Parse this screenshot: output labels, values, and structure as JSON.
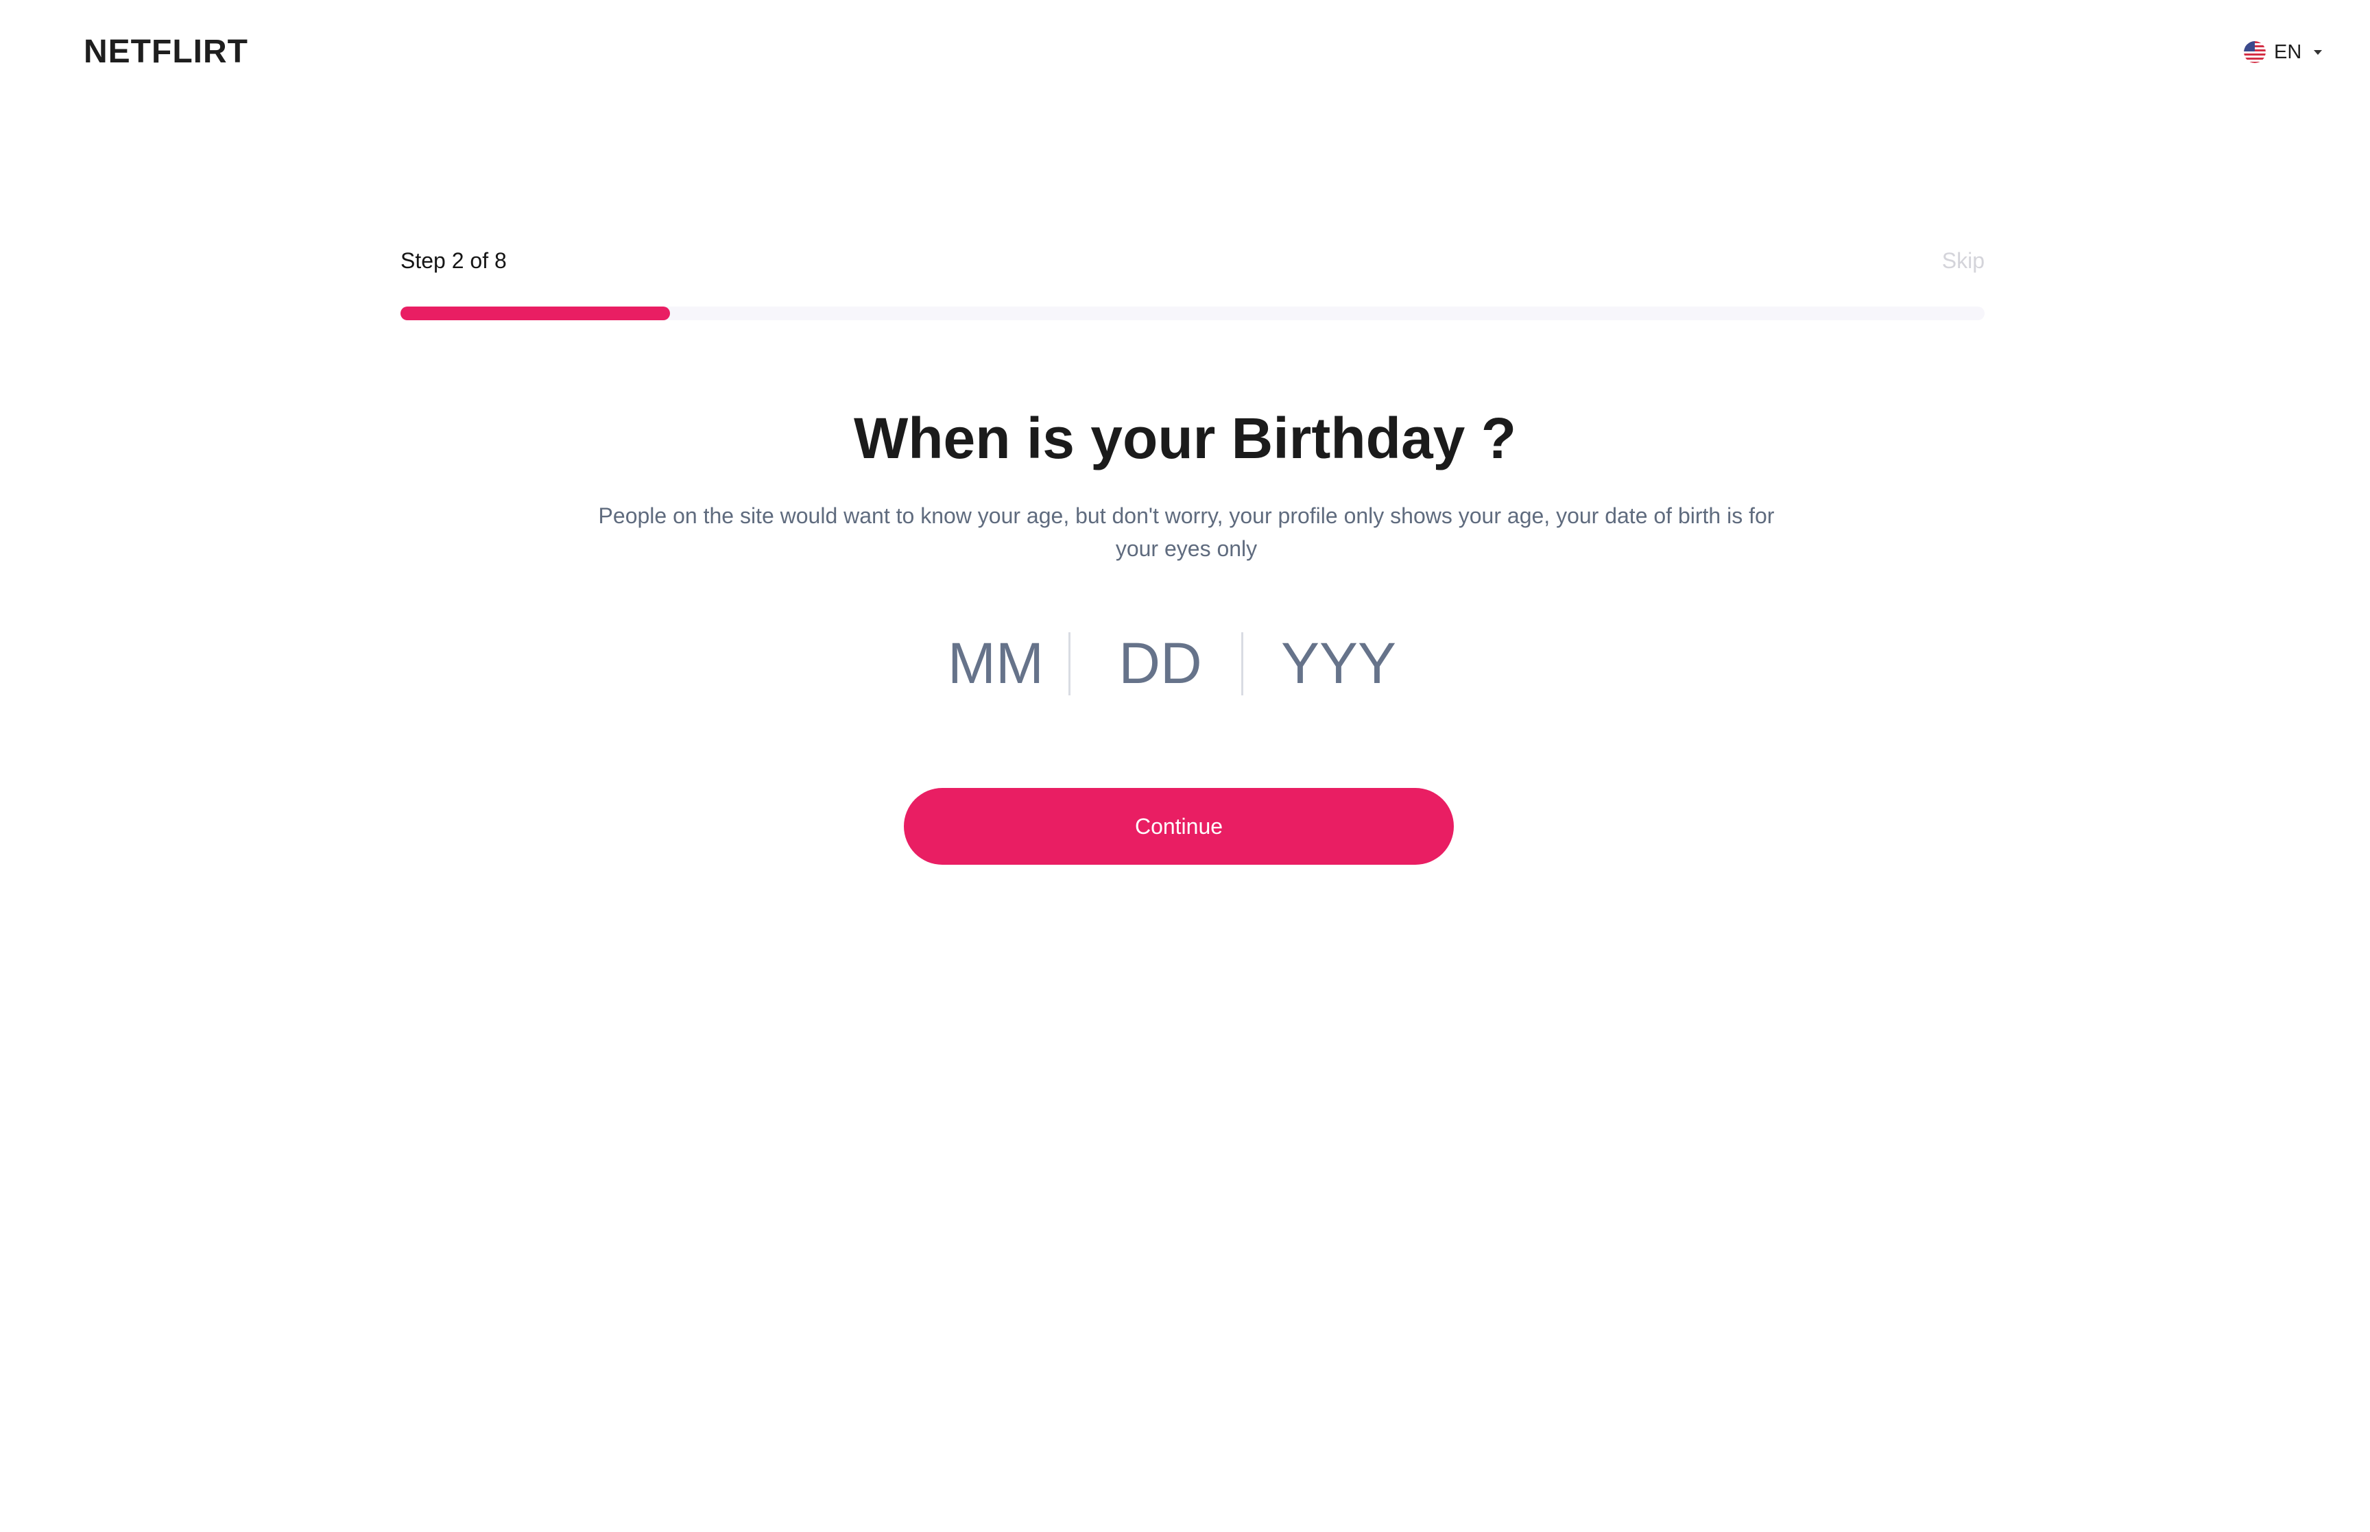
{
  "header": {
    "logo_text": "NETFLIRT",
    "language": {
      "label": "EN",
      "flag_icon": "us-flag-icon"
    }
  },
  "progress": {
    "step_text": "Step 2 of 8",
    "current_step": 2,
    "total_steps": 8,
    "fill_fraction": 0.17,
    "skip_label": "Skip",
    "accent_color": "#e91e63"
  },
  "main": {
    "title": "When is your Birthday ?",
    "subtitle": "People on the site would want to know your age, but don't worry, your profile only shows your age, your date of birth is for your eyes only",
    "date_fields": {
      "month_placeholder": "MM",
      "day_placeholder": "DD",
      "year_placeholder": "YYY"
    },
    "continue_label": "Continue"
  }
}
